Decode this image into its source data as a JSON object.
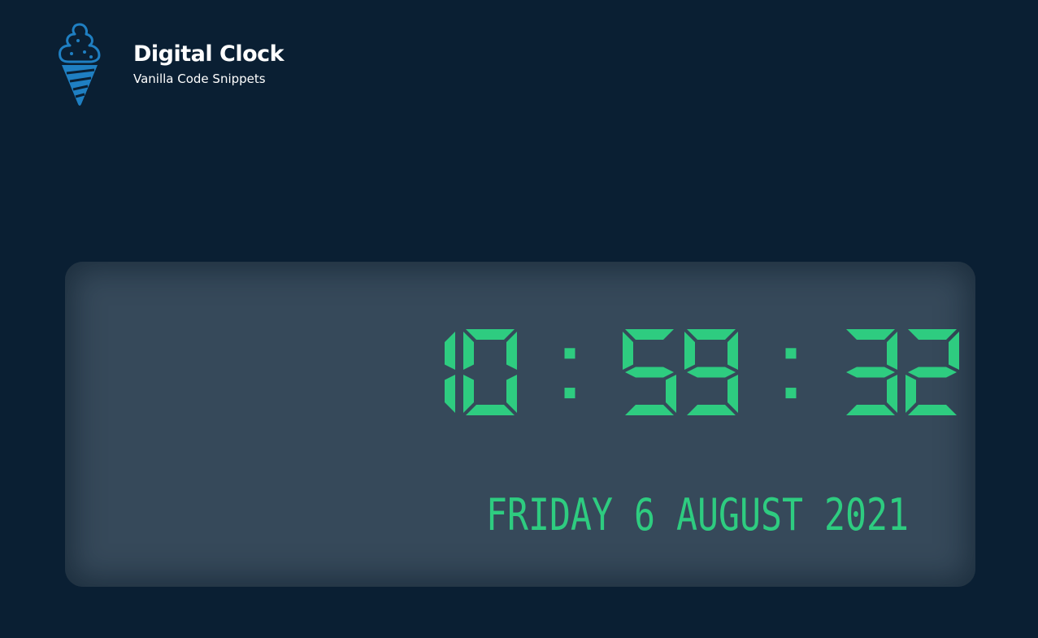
{
  "app": {
    "title": "Digital Clock",
    "subtitle": "Vanilla Code Snippets",
    "logo_icon": "ice-cream-cone-icon"
  },
  "clock": {
    "time": "10:59:32",
    "date": "FRIDAY 6 AUGUST 2021"
  },
  "colors": {
    "background": "#0a1f33",
    "panel": "#36495a",
    "digits": "#2ecc80",
    "logo": "#1f7fc2"
  }
}
